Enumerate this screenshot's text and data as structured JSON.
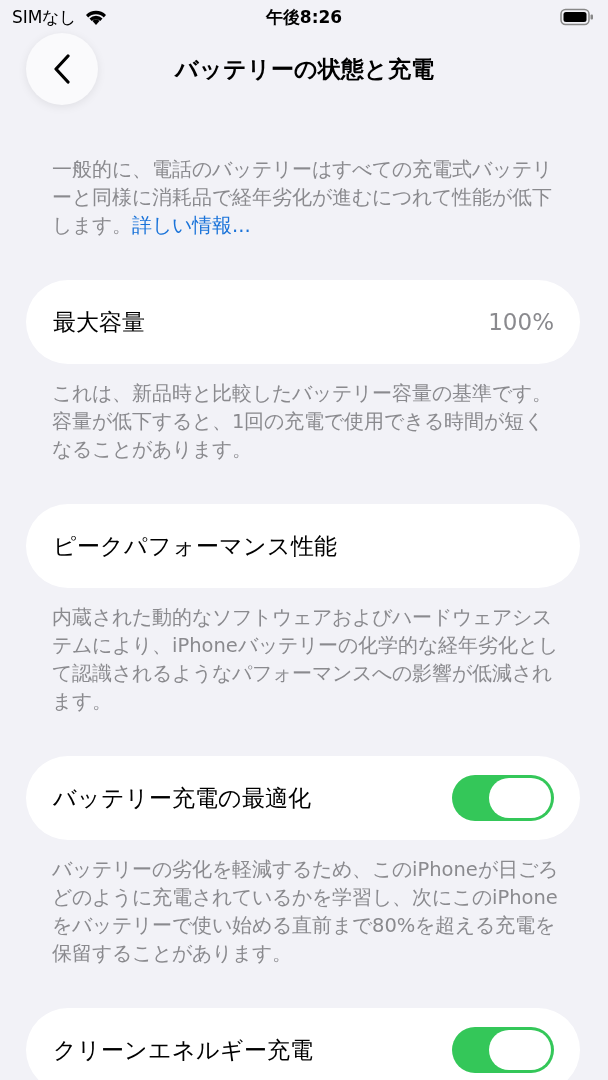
{
  "status_bar": {
    "carrier": "SIMなし",
    "time": "午後8:26"
  },
  "nav": {
    "title": "バッテリーの状態と充電"
  },
  "intro": {
    "text": "一般的に、電話のバッテリーはすべての充電式バッテリーと同様に消耗品で経年劣化が進むにつれて性能が低下します。",
    "link": "詳しい情報..."
  },
  "sections": [
    {
      "kind": "value",
      "label": "最大容量",
      "value": "100%",
      "footer": "これは、新品時と比較したバッテリー容量の基準です。容量が低下すると、1回の充電で使用できる時間が短くなることがあります。"
    },
    {
      "kind": "plain",
      "label": "ピークパフォーマンス性能",
      "footer": "内蔵された動的なソフトウェアおよびハードウェアシステムにより、iPhoneバッテリーの化学的な経年劣化として認識されるようなパフォーマンスへの影響が低減されます。"
    },
    {
      "kind": "toggle",
      "label": "バッテリー充電の最適化",
      "on": true,
      "footer": "バッテリーの劣化を軽減するため、このiPhoneが日ごろどのように充電されているかを学習し、次にこのiPhoneをバッテリーで使い始める直前まで80%を超える充電を保留することがあります。"
    },
    {
      "kind": "toggle",
      "label": "クリーンエネルギー充電",
      "on": true
    }
  ]
}
